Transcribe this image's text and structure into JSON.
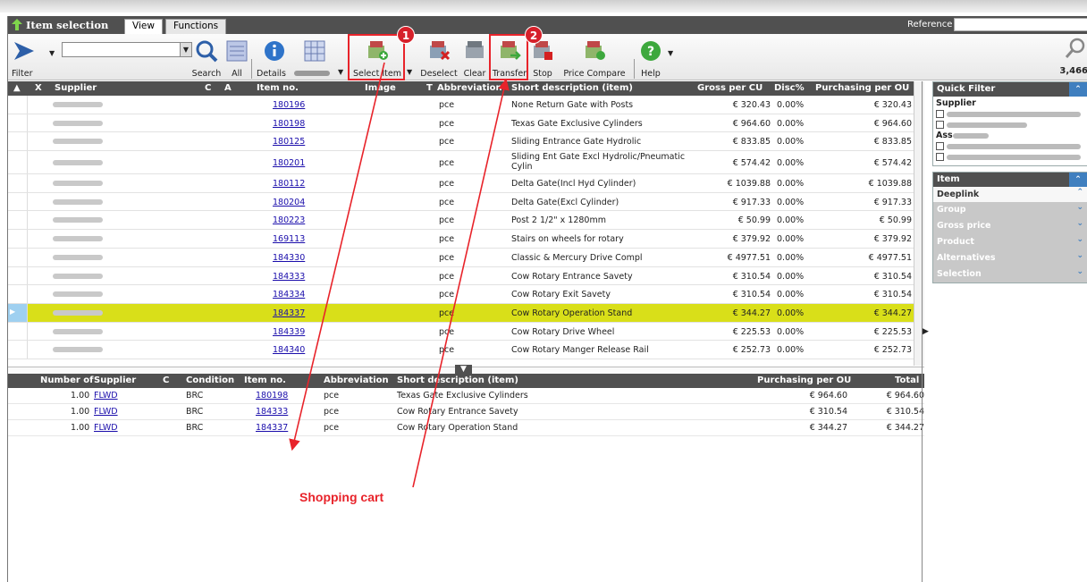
{
  "titlebar": {
    "title": "Item selection",
    "tabs": [
      "View",
      "Functions"
    ],
    "reference_label": "Reference"
  },
  "toolbar": {
    "filter": "Filter",
    "search": "Search",
    "all": "All",
    "details": "Details",
    "select_item": "Select Item",
    "deselect": "Deselect",
    "clear": "Clear",
    "transfer": "Transfer",
    "stop": "Stop",
    "price_compare": "Price Compare",
    "help": "Help",
    "count": "3,466"
  },
  "badges": [
    "1",
    "2"
  ],
  "grid": {
    "headers": [
      "X",
      "Supplier",
      "C",
      "A",
      "Item no.",
      "Image",
      "T",
      "Abbreviation",
      "Short description (item)",
      "Gross per CU",
      "Disc%",
      "Purchasing per OU"
    ],
    "rows": [
      {
        "item": "180196",
        "abbr": "pce",
        "desc": "None Return Gate with Posts",
        "gross": "€ 320.43",
        "disc": "0.00%",
        "ou": "€ 320.43"
      },
      {
        "item": "180198",
        "abbr": "pce",
        "desc": "Texas Gate Exclusive Cylinders",
        "gross": "€ 964.60",
        "disc": "0.00%",
        "ou": "€ 964.60"
      },
      {
        "item": "180125",
        "abbr": "pce",
        "desc": "Sliding Entrance Gate Hydrolic",
        "gross": "€ 833.85",
        "disc": "0.00%",
        "ou": "€ 833.85"
      },
      {
        "item": "180201",
        "abbr": "pce",
        "desc": "Sliding Ent Gate Excl Hydrolic/Pneumatic",
        "desc2": "Cylin",
        "gross": "€ 574.42",
        "disc": "0.00%",
        "ou": "€ 574.42"
      },
      {
        "item": "180112",
        "abbr": "pce",
        "desc": "Delta Gate(Incl Hyd Cylinder)",
        "gross": "€ 1039.88",
        "disc": "0.00%",
        "ou": "€ 1039.88"
      },
      {
        "item": "180204",
        "abbr": "pce",
        "desc": "Delta Gate(Excl Cylinder)",
        "gross": "€ 917.33",
        "disc": "0.00%",
        "ou": "€ 917.33"
      },
      {
        "item": "180223",
        "abbr": "pce",
        "desc": "Post 2 1/2\" x 1280mm",
        "gross": "€ 50.99",
        "disc": "0.00%",
        "ou": "€ 50.99"
      },
      {
        "item": "169113",
        "abbr": "pce",
        "desc": "Stairs on wheels for rotary",
        "gross": "€ 379.92",
        "disc": "0.00%",
        "ou": "€ 379.92"
      },
      {
        "item": "184330",
        "abbr": "pce",
        "desc": "Classic & Mercury Drive Compl",
        "gross": "€ 4977.51",
        "disc": "0.00%",
        "ou": "€ 4977.51"
      },
      {
        "item": "184333",
        "abbr": "pce",
        "desc": "Cow Rotary Entrance Savety",
        "gross": "€ 310.54",
        "disc": "0.00%",
        "ou": "€ 310.54"
      },
      {
        "item": "184334",
        "abbr": "pce",
        "desc": "Cow Rotary Exit Savety",
        "gross": "€ 310.54",
        "disc": "0.00%",
        "ou": "€ 310.54"
      },
      {
        "item": "184337",
        "abbr": "pce",
        "desc": "Cow Rotary Operation Stand",
        "gross": "€ 344.27",
        "disc": "0.00%",
        "ou": "€ 344.27"
      },
      {
        "item": "184339",
        "abbr": "pce",
        "desc": "Cow Rotary Drive Wheel",
        "gross": "€ 225.53",
        "disc": "0.00%",
        "ou": "€ 225.53"
      },
      {
        "item": "184340",
        "abbr": "pce",
        "desc": "Cow Rotary Manger Release Rail",
        "gross": "€ 252.73",
        "disc": "0.00%",
        "ou": "€ 252.73"
      }
    ]
  },
  "cart": {
    "headers": [
      "Number of",
      "Supplier",
      "C",
      "Condition",
      "Item no.",
      "Abbreviation",
      "Short description (item)",
      "Purchasing per OU",
      "Total"
    ],
    "rows": [
      {
        "num": "1.00",
        "supplier": "FLWD",
        "cond": "BRC",
        "item": "180198",
        "abbr": "pce",
        "desc": "Texas Gate Exclusive Cylinders",
        "ou": "€ 964.60",
        "total": "€ 964.60"
      },
      {
        "num": "1.00",
        "supplier": "FLWD",
        "cond": "BRC",
        "item": "184333",
        "abbr": "pce",
        "desc": "Cow Rotary Entrance Savety",
        "ou": "€ 310.54",
        "total": "€ 310.54"
      },
      {
        "num": "1.00",
        "supplier": "FLWD",
        "cond": "BRC",
        "item": "184337",
        "abbr": "pce",
        "desc": "Cow Rotary Operation Stand",
        "ou": "€ 344.27",
        "total": "€ 344.27"
      }
    ]
  },
  "quick_filter": {
    "title": "Quick Filter",
    "supplier": "Supplier",
    "assortment": "Ass"
  },
  "item_panel": {
    "title": "Item",
    "rows": [
      "Deeplink",
      "Group",
      "Gross price",
      "Product",
      "Alternatives",
      "Selection"
    ]
  },
  "annotation": "Shopping cart",
  "colors": {
    "header": "#505050",
    "selected_row": "#d9df19",
    "annotation": "#e8232a"
  }
}
